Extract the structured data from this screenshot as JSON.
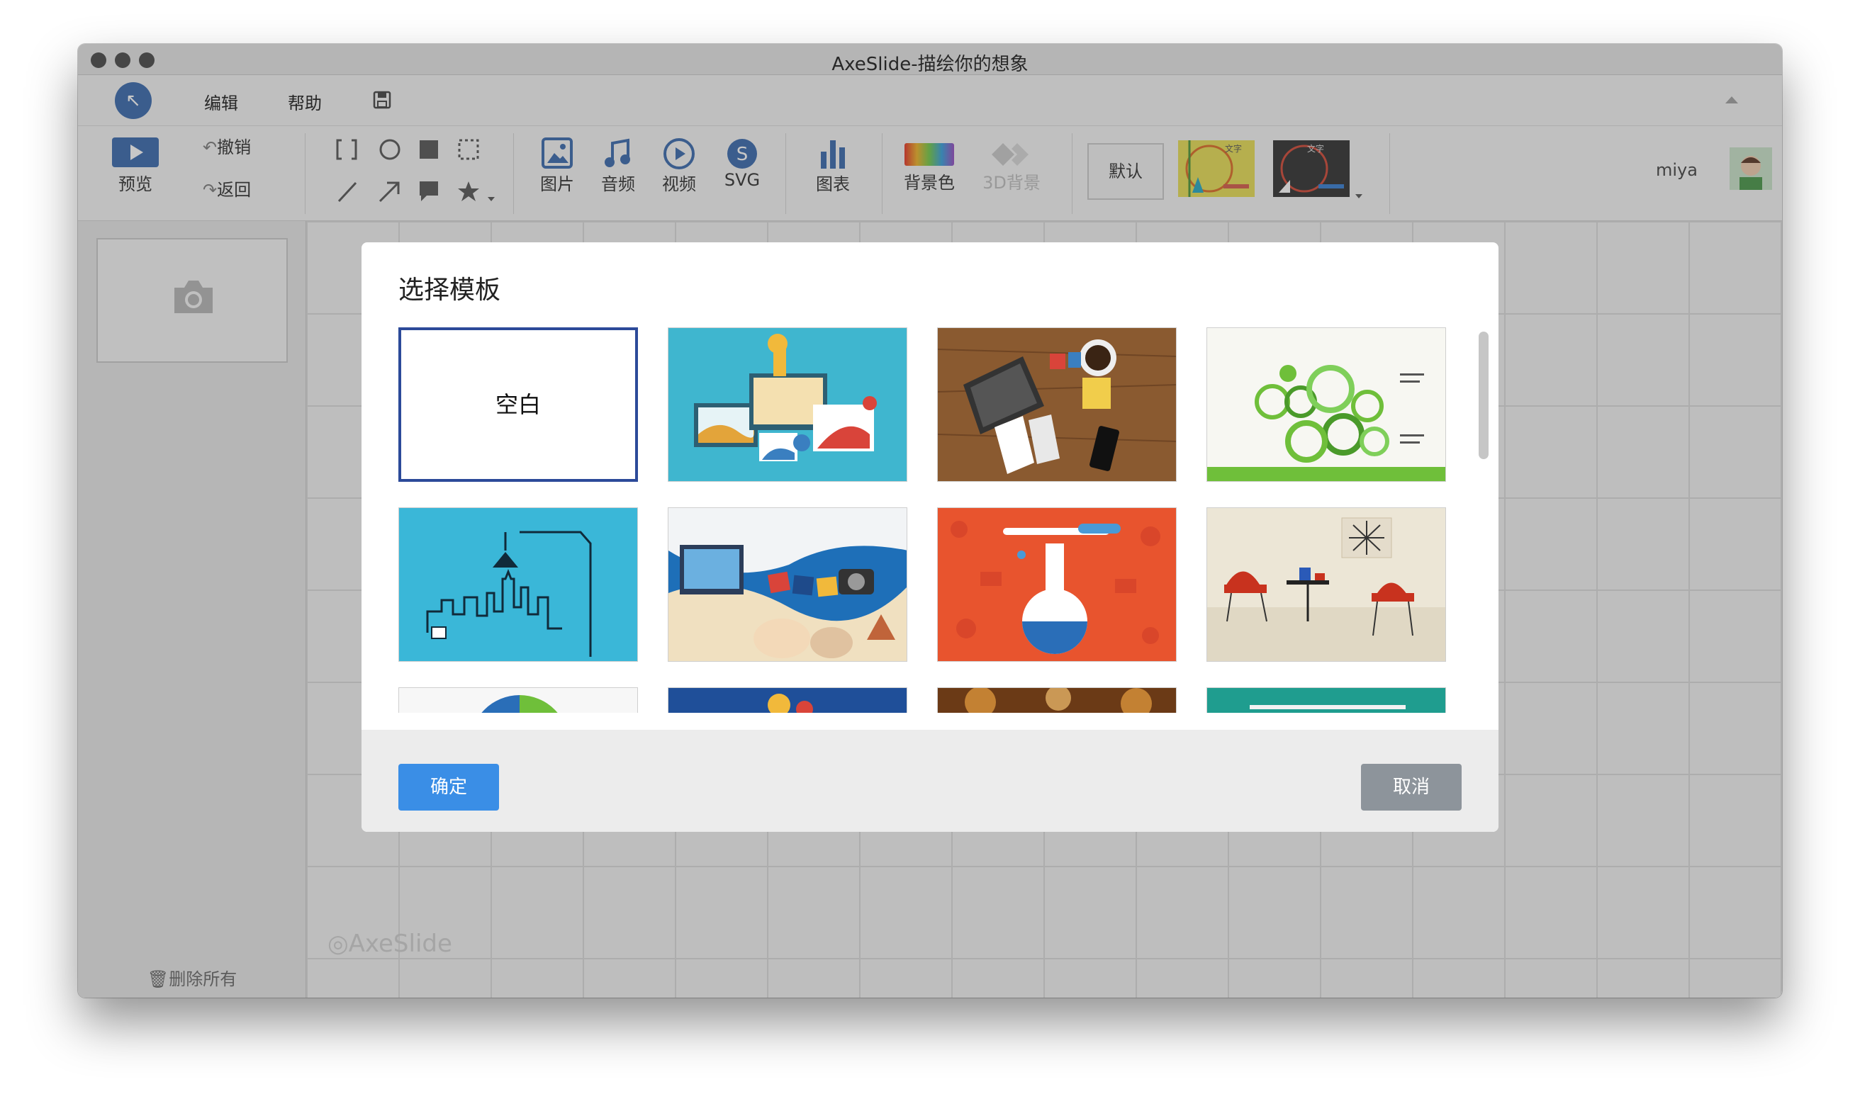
{
  "window": {
    "title": "AxeSlide-描绘你的想象"
  },
  "menu": {
    "logo_glyph": "↖",
    "edit": "编辑",
    "help": "帮助",
    "save_icon": "save-icon"
  },
  "toolbar": {
    "preview": "预览",
    "undo": "撤销",
    "back": "返回",
    "image": "图片",
    "audio": "音频",
    "video": "视频",
    "svg": "SVG",
    "chart": "图表",
    "background_color": "背景色",
    "background_3d": "3D背景",
    "theme_default": "默认",
    "theme_thumb_text": "文字",
    "user": "miya"
  },
  "sidebar": {
    "delete_all": "删除所有"
  },
  "canvas": {
    "watermark": "AxeSlide"
  },
  "modal": {
    "title": "选择模板",
    "blank_label": "空白",
    "confirm": "确定",
    "cancel": "取消",
    "templates": [
      {
        "name": "blank",
        "selected": true
      },
      {
        "name": "devices"
      },
      {
        "name": "wood-desk"
      },
      {
        "name": "green-gears"
      },
      {
        "name": "city-skyline"
      },
      {
        "name": "seashells"
      },
      {
        "name": "orange-lab"
      },
      {
        "name": "red-chairs"
      },
      {
        "name": "pie-chart"
      },
      {
        "name": "blue-people"
      },
      {
        "name": "warm-lights"
      },
      {
        "name": "teal-board"
      }
    ]
  },
  "colors": {
    "accent": "#3a8ee6",
    "cancel": "#8d949b",
    "selected_border": "#2c4a99"
  }
}
